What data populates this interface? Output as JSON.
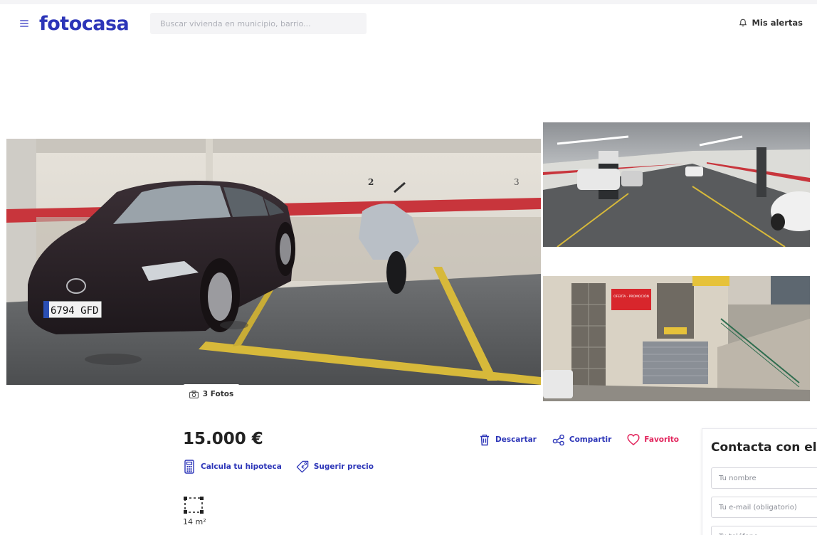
{
  "header": {
    "logo": "fotocasa",
    "search_placeholder": "Buscar vivienda en municipio, barrio...",
    "alerts_label": "Mis alertas"
  },
  "gallery": {
    "photos_label": "3 Fotos",
    "main_plate": "6794 GFD",
    "wall_numbers": [
      "2",
      "3"
    ],
    "side_sign_label": "OFERTA · PROMOCIÓN"
  },
  "listing": {
    "price": "15.000 €",
    "tools": {
      "mortgage": "Calcula tu hipoteca",
      "suggest": "Sugerir precio"
    },
    "actions": {
      "discard": "Descartar",
      "share": "Compartir",
      "favorite": "Favorito"
    },
    "surface": "14 m²"
  },
  "contact": {
    "title": "Contacta con el a",
    "name_placeholder": "Tu nombre",
    "email_placeholder": "Tu e-mail (obligatorio)",
    "phone_placeholder": "Tu teléfono"
  },
  "colors": {
    "brand": "#2c35b8",
    "favorite": "#e2245c",
    "search_bg": "#f4f4f6"
  }
}
